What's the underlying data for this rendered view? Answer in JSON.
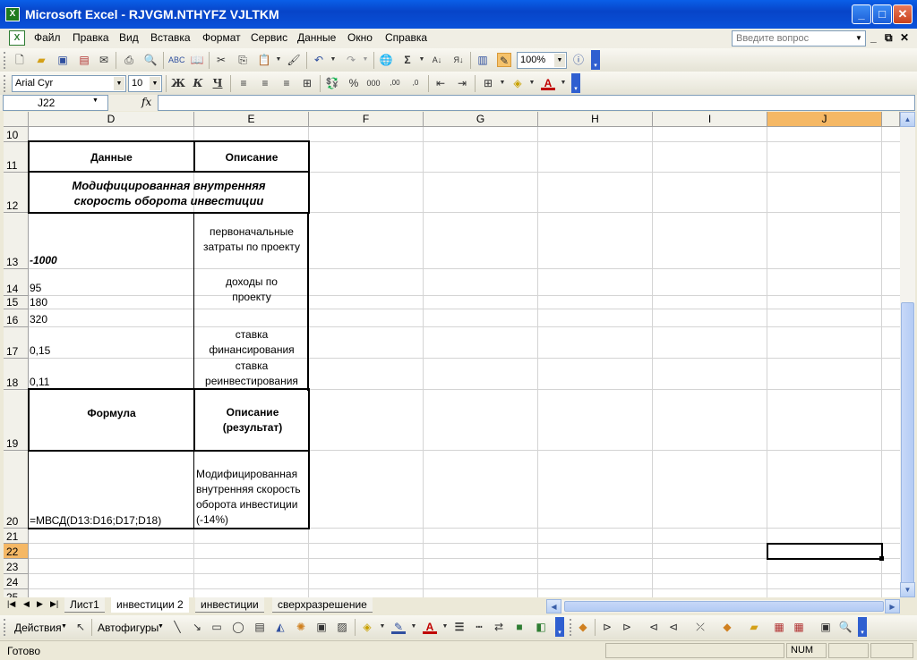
{
  "window": {
    "title": "Microsoft Excel - RJVGM.NTHYFZ VJLTKM"
  },
  "menu": {
    "items": [
      "Файл",
      "Правка",
      "Вид",
      "Вставка",
      "Формат",
      "Сервис",
      "Данные",
      "Окно",
      "Справка"
    ],
    "help_placeholder": "Введите вопрос"
  },
  "toolbar": {
    "zoom": "100%"
  },
  "format_toolbar": {
    "font": "Arial Cyr",
    "size": "10"
  },
  "formula_bar": {
    "name_box": "J22",
    "fx_label": "fx",
    "formula": ""
  },
  "sheet": {
    "columns": [
      "D",
      "E",
      "F",
      "G",
      "H",
      "I",
      "J"
    ],
    "rows": [
      "10",
      "11",
      "12",
      "13",
      "14",
      "15",
      "16",
      "17",
      "18",
      "19",
      "20",
      "21",
      "22",
      "23",
      "24",
      "25"
    ],
    "selected_cell": "J22",
    "cells": {
      "d11": "Данные",
      "e11": "Описание",
      "d12": "Модифицированная внутренняя скорость оборота инвестиции",
      "d13": "-1000",
      "e13": "первоначальные затраты по проекту",
      "d14": "95",
      "e14": "доходы по проекту",
      "d15": "180",
      "d16": "320",
      "d17": "0,15",
      "e17": "ставка финансирования",
      "d18": "0,11",
      "e18": "ставка реинвестирования",
      "d19": "Формула",
      "e19": "Описание (результат)",
      "d20": "=МВСД(D13:D16;D17;D18)",
      "e20": "Модифицированная внутренняя скорость оборота инвестиции (-14%)"
    }
  },
  "tabs": [
    "Лист1",
    "инвестиции 2",
    "инвестиции",
    "сверхразрешение"
  ],
  "active_tab": "инвестиции 2",
  "drawing": {
    "actions": "Действия",
    "autoshapes": "Автофигуры"
  },
  "status": {
    "ready": "Готово",
    "num": "NUM"
  }
}
